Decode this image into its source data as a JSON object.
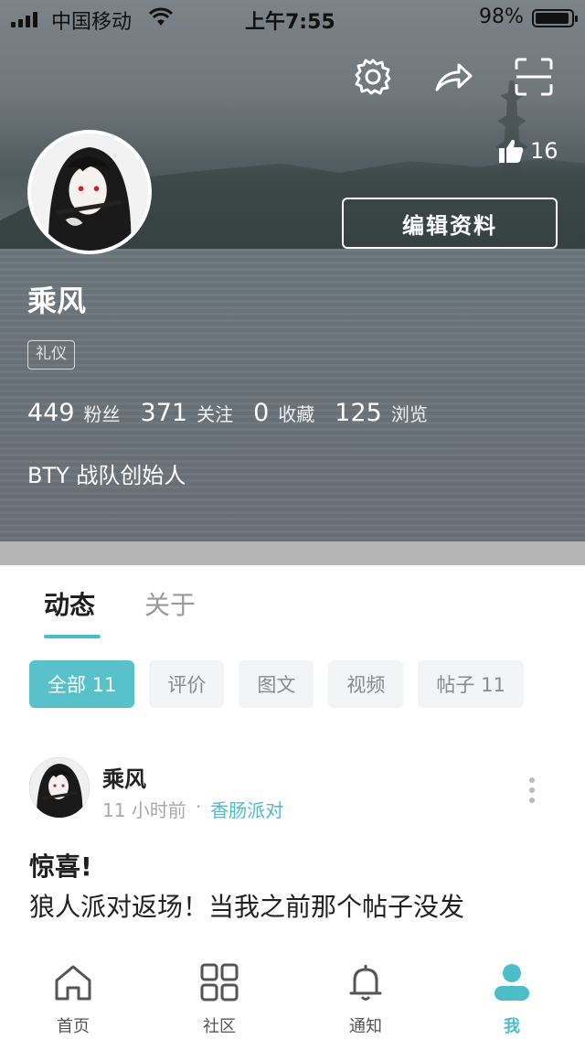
{
  "status_bar": {
    "carrier": "中国移动",
    "time": "上午7:55",
    "battery": "98%"
  },
  "profile": {
    "likes": "16",
    "edit_label": "编辑资料",
    "name": "乘风",
    "tag": "礼仪",
    "stats": [
      {
        "value": "449",
        "label": "粉丝"
      },
      {
        "value": "371",
        "label": "关注"
      },
      {
        "value": "0",
        "label": "收藏"
      },
      {
        "value": "125",
        "label": "浏览"
      }
    ],
    "bio": "BTY 战队创始人"
  },
  "tabs": {
    "active": "动态",
    "inactive": "关于"
  },
  "filters": [
    {
      "label": "全部 11",
      "active": true
    },
    {
      "label": "评价",
      "active": false
    },
    {
      "label": "图文",
      "active": false
    },
    {
      "label": "视频",
      "active": false
    },
    {
      "label": "帖子 11",
      "active": false
    }
  ],
  "post": {
    "author": "乘风",
    "time": "11 小时前",
    "separator": "·",
    "topic": "香肠派对",
    "title": "惊喜!",
    "body": "狼人派对返场！当我之前那个帖子没发"
  },
  "nav": [
    {
      "label": "首页",
      "icon": "home-icon"
    },
    {
      "label": "社区",
      "icon": "grid-icon"
    },
    {
      "label": "通知",
      "icon": "bell-icon"
    },
    {
      "label": "我",
      "icon": "person-icon"
    }
  ],
  "colors": {
    "accent": "#4dbec9",
    "chip_active": "#58c1c9"
  }
}
